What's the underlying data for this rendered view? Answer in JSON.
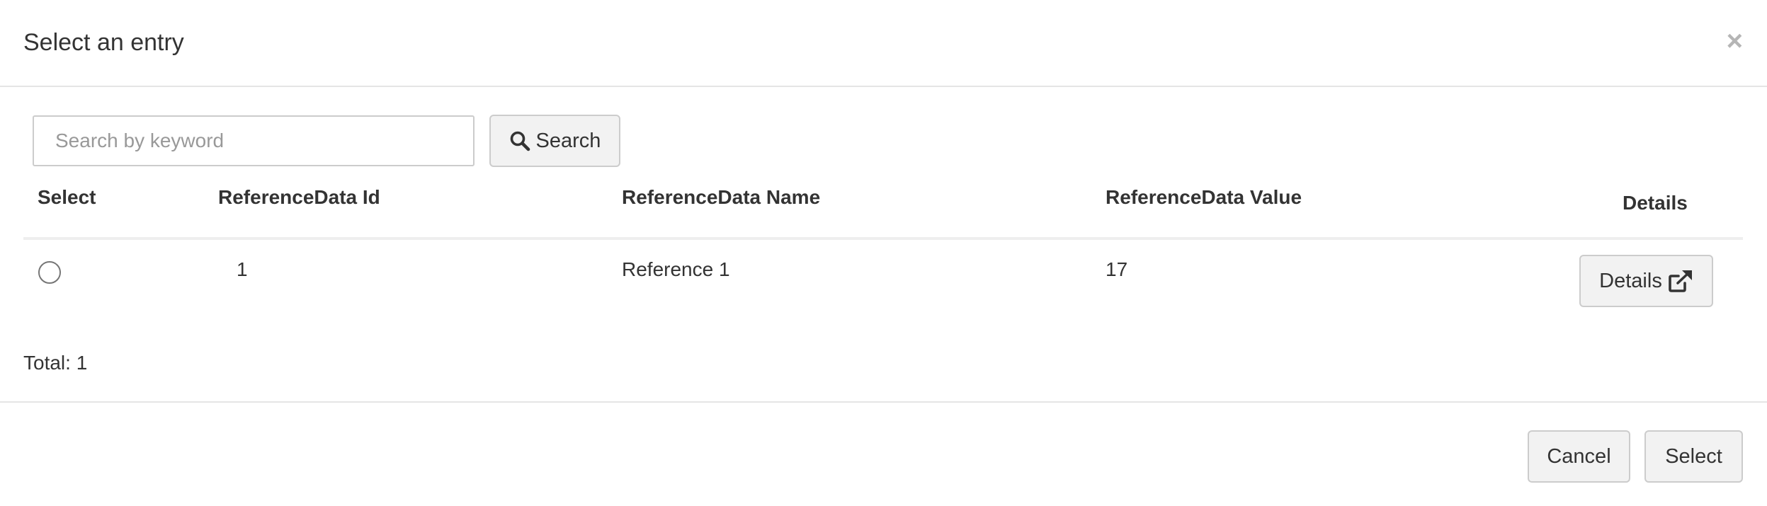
{
  "dialog": {
    "title": "Select an entry",
    "close_symbol": "×"
  },
  "search": {
    "placeholder": "Search by keyword",
    "value": "",
    "button_label": "Search",
    "button_icon": "search-icon"
  },
  "table": {
    "columns": [
      "Select",
      "ReferenceData Id",
      "ReferenceData Name",
      "ReferenceData Value",
      "Details"
    ],
    "rows": [
      {
        "selected": false,
        "id": "1",
        "name": "Reference 1",
        "value": "17",
        "details_label": "Details",
        "details_icon": "external-link-icon"
      }
    ]
  },
  "total_text": "Total: 1",
  "footer": {
    "cancel_label": "Cancel",
    "select_label": "Select"
  },
  "colors": {
    "button_bg": "#f2f2f2",
    "border": "#cccccc",
    "text": "#333333",
    "close_icon": "#b5b5b5"
  }
}
